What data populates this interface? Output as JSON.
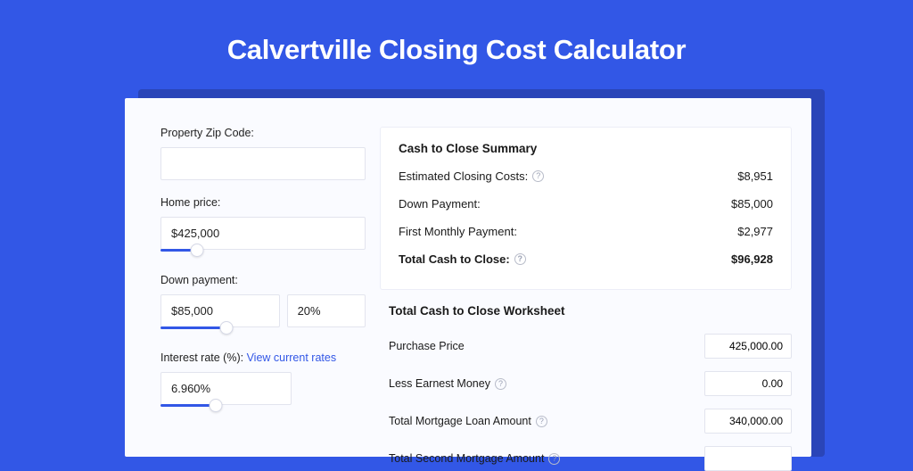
{
  "title": "Calvertville Closing Cost Calculator",
  "inputs": {
    "zip": {
      "label": "Property Zip Code:",
      "value": ""
    },
    "home_price": {
      "label": "Home price:",
      "value": "$425,000",
      "slider_pct": 18
    },
    "down_payment": {
      "label": "Down payment:",
      "value": "$85,000",
      "pct": "20%",
      "slider_pct": 32
    },
    "interest_rate": {
      "label": "Interest rate (%): ",
      "link": "View current rates",
      "value": "6.960%",
      "slider_pct": 42
    }
  },
  "summary": {
    "title": "Cash to Close Summary",
    "rows": [
      {
        "label": "Estimated Closing Costs:",
        "help": true,
        "value": "$8,951"
      },
      {
        "label": "Down Payment:",
        "help": false,
        "value": "$85,000"
      },
      {
        "label": "First Monthly Payment:",
        "help": false,
        "value": "$2,977"
      }
    ],
    "total": {
      "label": "Total Cash to Close:",
      "help": true,
      "value": "$96,928"
    }
  },
  "worksheet": {
    "title": "Total Cash to Close Worksheet",
    "rows": [
      {
        "label": "Purchase Price",
        "help": false,
        "value": "425,000.00"
      },
      {
        "label": "Less Earnest Money",
        "help": true,
        "value": "0.00"
      },
      {
        "label": "Total Mortgage Loan Amount",
        "help": true,
        "value": "340,000.00"
      },
      {
        "label": "Total Second Mortgage Amount",
        "help": true,
        "value": ""
      }
    ]
  }
}
